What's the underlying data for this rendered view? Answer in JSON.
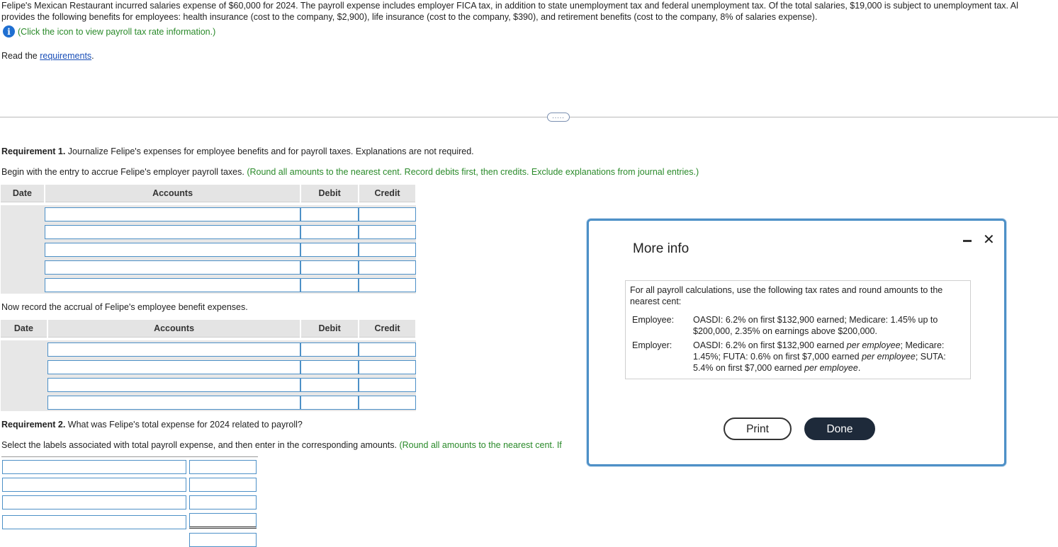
{
  "problem": {
    "line1": "Felipe's Mexican Restaurant incurred salaries expense of $60,000 for 2024. The payroll expense includes employer FICA tax, in addition to state unemployment tax and federal unemployment tax. Of the total salaries, $19,000 is subject to unemployment tax. Al",
    "line2": "provides the following benefits for employees: health insurance (cost to the company, $2,900), life insurance (cost to the company, $390), and retirement benefits (cost to the company, 8% of salaries expense).",
    "icon_link": "(Click the icon to view payroll tax rate information.)",
    "read_prefix": "Read the ",
    "read_link": "requirements",
    "read_suffix": "."
  },
  "divider": {
    "ellipsis": "....."
  },
  "req1": {
    "title_bold": "Requirement 1.",
    "title_rest": " Journalize Felipe's expenses for employee benefits and for payroll taxes. Explanations are not required.",
    "begin": "Begin with the entry to accrue Felipe's employer payroll taxes. ",
    "begin_note": "(Round all amounts to the nearest cent. Record debits first, then credits. Exclude explanations from journal entries.)",
    "table1_headers": {
      "date": "Date",
      "accounts": "Accounts",
      "debit": "Debit",
      "credit": "Credit"
    },
    "now_record": "Now record the accrual of Felipe's employee benefit expenses.",
    "table2_headers": {
      "date": "Date",
      "accounts": "Accounts",
      "debit": "Debit",
      "credit": "Credit"
    }
  },
  "req2": {
    "title_bold": "Requirement 2.",
    "title_rest": " What was Felipe's total expense for 2024 related to payroll?",
    "select": "Select the labels associated with total payroll expense, and then enter in the corresponding amounts. ",
    "select_note": "(Round all amounts to the nearest cent. If"
  },
  "modal": {
    "title": "More info",
    "close": "✕",
    "intro": "For all payroll calculations, use the following tax rates and round amounts to the nearest cent:",
    "employee_label": "Employee:",
    "employee_text": "OASDI: 6.2% on first $132,900 earned; Medicare: 1.45% up to $200,000, 2.35% on earnings above $200,000.",
    "employer_label": "Employer:",
    "employer_text_1": "OASDI: 6.2% on first $132,900 earned ",
    "employer_em_1": "per employee",
    "employer_text_2": "; Medicare: 1.45%; FUTA: 0.6% on first $7,000 earned ",
    "employer_em_2": "per employee",
    "employer_text_3": "; SUTA: 5.4% on first $7,000 earned ",
    "employer_em_3": "per employee",
    "employer_text_4": ".",
    "print_label": "Print",
    "done_label": "Done"
  },
  "colors": {
    "accent": "#4d90c7",
    "note_green": "#2a8a2a",
    "link_blue": "#1a4fb8",
    "done_bg": "#1e2a3a"
  }
}
